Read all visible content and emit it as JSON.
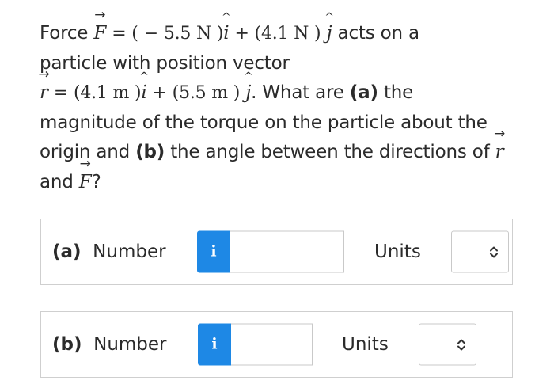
{
  "question": {
    "t_force": "Force",
    "force_symbol": "F",
    "eq1": "= (",
    "force_x": "− 5.5 N )",
    "i_unit": "i",
    "plus1": "+ (",
    "force_y": "4.1 N )",
    "j_unit": "j",
    "t_acts": "acts on a",
    "t_particle": "particle with position vector",
    "pos_symbol": "r",
    "eq2": "= (",
    "pos_x": "4.1 m )",
    "plus2": "+ (",
    "pos_y": "5.5 m )",
    "t_whatare": ". What are",
    "part_a": "(a)",
    "t_the_mag": "the",
    "t_magnitude": "magnitude of the torque on the particle about the",
    "t_origin": "origin and",
    "part_b": "(b)",
    "t_angle": "the angle between the directions of",
    "t_and": "and",
    "t_qmark": "?"
  },
  "answer_a": {
    "label_part": "(a)",
    "label_text": "Number",
    "info": "i",
    "value": "",
    "units_label": "Units",
    "units_value": ""
  },
  "answer_b": {
    "label_part": "(b)",
    "label_text": "Number",
    "info": "i",
    "value": "",
    "units_label": "Units",
    "units_value": ""
  },
  "colors": {
    "info_button": "#1e88e5",
    "text": "#2b2b2b",
    "border": "#cfcfcf"
  },
  "icons": {
    "info": "info-icon",
    "units_dropdown": "up-down-chevron-icon"
  }
}
